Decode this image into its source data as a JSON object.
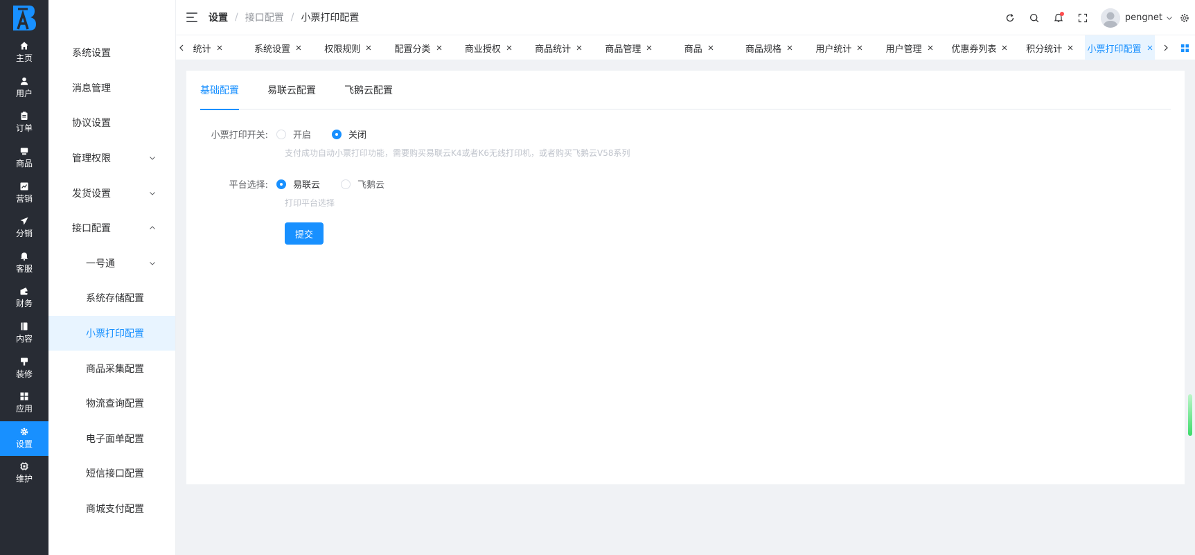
{
  "rail": {
    "items": [
      {
        "label": "主页",
        "icon": "home-icon"
      },
      {
        "label": "用户",
        "icon": "user-icon"
      },
      {
        "label": "订单",
        "icon": "clipboard-icon"
      },
      {
        "label": "商品",
        "icon": "box-icon"
      },
      {
        "label": "营销",
        "icon": "chart-icon"
      },
      {
        "label": "分销",
        "icon": "send-icon"
      },
      {
        "label": "客服",
        "icon": "bell-icon"
      },
      {
        "label": "财务",
        "icon": "wallet-icon"
      },
      {
        "label": "内容",
        "icon": "book-icon"
      },
      {
        "label": "装修",
        "icon": "brush-icon"
      },
      {
        "label": "应用",
        "icon": "apps-icon"
      },
      {
        "label": "设置",
        "icon": "gear-icon"
      },
      {
        "label": "维护",
        "icon": "chip-icon"
      }
    ],
    "active_index": 11,
    "accent": "#1890ff"
  },
  "submenu": {
    "items": [
      {
        "label": "系统设置"
      },
      {
        "label": "消息管理"
      },
      {
        "label": "协议设置"
      },
      {
        "label": "管理权限"
      },
      {
        "label": "发货设置"
      },
      {
        "label": "接口配置"
      },
      {
        "label": "一号通"
      },
      {
        "label": "系统存储配置"
      },
      {
        "label": "小票打印配置"
      },
      {
        "label": "商品采集配置"
      },
      {
        "label": "物流查询配置"
      },
      {
        "label": "电子面单配置"
      },
      {
        "label": "短信接口配置"
      },
      {
        "label": "商城支付配置"
      }
    ]
  },
  "header": {
    "breadcrumb": [
      "设置",
      "接口配置",
      "小票打印配置"
    ],
    "separator": "/",
    "username": "pengnet"
  },
  "tabs": {
    "items": [
      {
        "label": "统计"
      },
      {
        "label": "系统设置"
      },
      {
        "label": "权限规则"
      },
      {
        "label": "配置分类"
      },
      {
        "label": "商业授权"
      },
      {
        "label": "商品统计"
      },
      {
        "label": "商品管理"
      },
      {
        "label": "商品"
      },
      {
        "label": "商品规格"
      },
      {
        "label": "用户统计"
      },
      {
        "label": "用户管理"
      },
      {
        "label": "优惠券列表"
      },
      {
        "label": "积分统计"
      },
      {
        "label": "小票打印配置"
      }
    ],
    "active_index": 13
  },
  "content": {
    "tabs": [
      "基础配置",
      "易联云配置",
      "飞鹅云配置"
    ],
    "active_tab": 0,
    "switch_field": {
      "label": "小票打印开关:",
      "options": [
        "开启",
        "关闭"
      ],
      "selected": "关闭",
      "help": "支付成功自动小票打印功能，需要购买易联云K4或者K6无线打印机，或者购买飞鹅云V58系列"
    },
    "platform_field": {
      "label": "平台选择:",
      "options": [
        "易联云",
        "飞鹅云"
      ],
      "selected": "易联云",
      "help": "打印平台选择"
    },
    "submit_label": "提交"
  }
}
